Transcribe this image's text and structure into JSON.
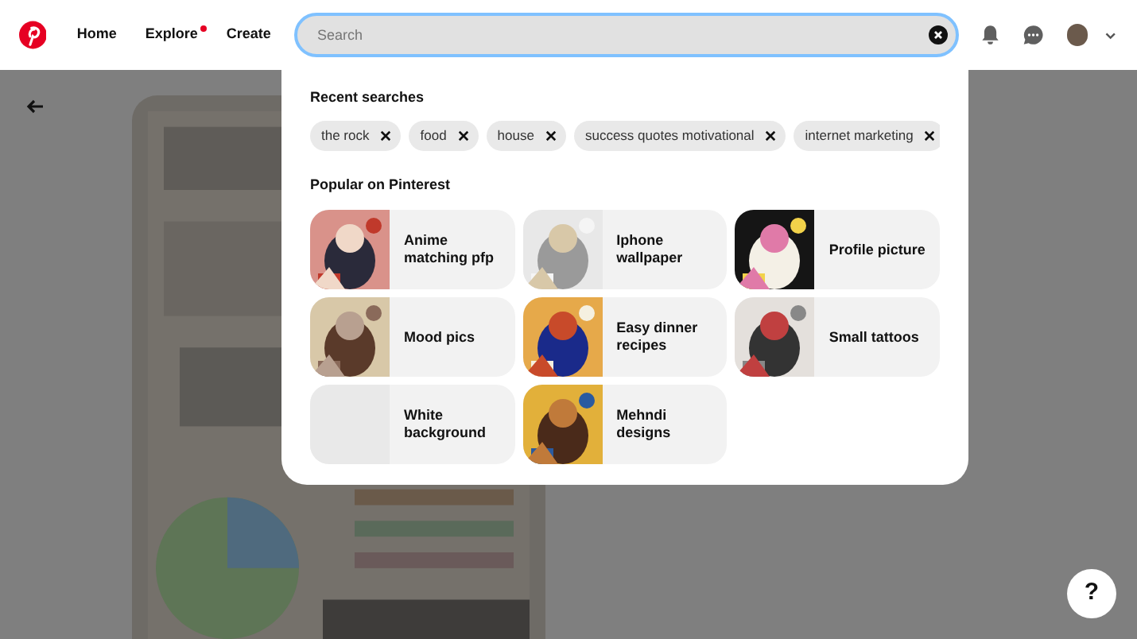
{
  "nav": [
    {
      "label": "Home",
      "dot": false
    },
    {
      "label": "Explore",
      "dot": true
    },
    {
      "label": "Create",
      "dot": false
    }
  ],
  "search": {
    "placeholder": "Search"
  },
  "recent": {
    "title": "Recent searches",
    "items": [
      "the rock",
      "food",
      "house",
      "success quotes motivational",
      "internet marketing"
    ]
  },
  "popular": {
    "title": "Popular on Pinterest",
    "items": [
      {
        "label": "Anime matching pfp",
        "kind": "picture"
      },
      {
        "label": "Iphone wallpaper",
        "kind": "picture"
      },
      {
        "label": "Profile picture",
        "kind": "picture"
      },
      {
        "label": "Mood pics",
        "kind": "picture"
      },
      {
        "label": "Easy dinner recipes",
        "kind": "picture"
      },
      {
        "label": "Small tattoos",
        "kind": "picture"
      },
      {
        "label": "White background",
        "kind": "blank"
      },
      {
        "label": "Mehndi designs",
        "kind": "picture"
      }
    ]
  },
  "help": {
    "label": "?"
  }
}
